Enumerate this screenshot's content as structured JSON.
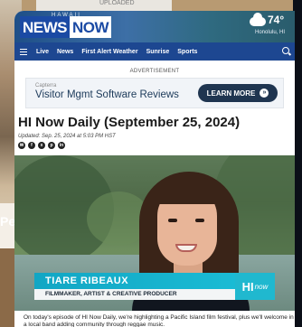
{
  "background": {
    "top_card_text": "UPLOADED",
    "left_text": "Pe"
  },
  "header": {
    "logo_news": "NEWS",
    "logo_now": "NOW",
    "logo_region": "HAWAII",
    "weather_temp": "74°",
    "weather_location": "Honolulu, HI"
  },
  "nav": {
    "items": [
      "Live",
      "News",
      "First Alert Weather",
      "Sunrise",
      "Sports"
    ]
  },
  "ad": {
    "label": "ADVERTISEMENT",
    "brand": "Capterra",
    "title": "Visitor Mgmt Software Reviews",
    "button_label": "LEARN MORE",
    "button_icon": "chevron-right-double"
  },
  "article": {
    "headline": "HI Now Daily (September 25, 2024)",
    "updated": "Updated: Sep. 25, 2024 at 5:03 PM HST",
    "share_icons": [
      "email-icon",
      "facebook-icon",
      "x-icon",
      "pinterest-icon",
      "linkedin-icon"
    ],
    "body": "On today's episode of HI Now Daily, we're highlighting a Pacific Island film festival, plus we'll welcome in a local band adding community through reggae music."
  },
  "video": {
    "lower_third_name": "TIARE RIBEAUX",
    "lower_third_role": "FILMMAKER, ARTIST & CREATIVE PRODUCER",
    "lower_third_logo_hi": "HI",
    "lower_third_logo_now": "now"
  }
}
